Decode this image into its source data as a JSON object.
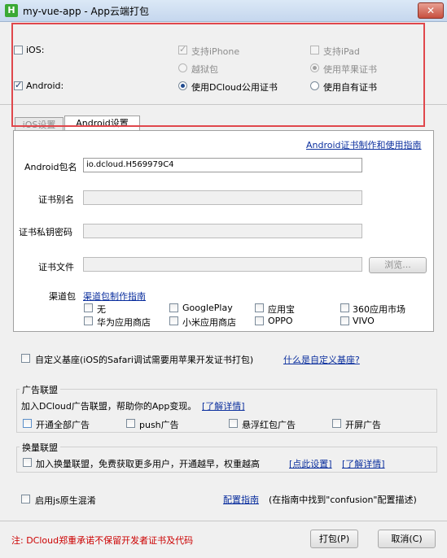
{
  "window": {
    "title": "my-vue-app - App云端打包",
    "icon_letter": "H",
    "close": "✕"
  },
  "platform": {
    "ios_label": "iOS:",
    "iphone": "支持iPhone",
    "ipad": "支持iPad",
    "jailbreak": "越狱包",
    "apple_cert": "使用苹果证书",
    "android_label": "Android:",
    "dcloud_cert": "使用DCloud公用证书",
    "own_cert": "使用自有证书"
  },
  "tabs": {
    "ios": "iOS设置",
    "android": "Android设置"
  },
  "android": {
    "cert_link": "Android证书制作和使用指南",
    "package_label": "Android包名",
    "package_value": "io.dcloud.H569979C4",
    "alias_label": "证书别名",
    "password_label": "证书私钥密码",
    "file_label": "证书文件",
    "browse": "浏览...",
    "channel_label": "渠道包",
    "channel_link": "渠道包制作指南",
    "channels": [
      "无",
      "GooglePlay",
      "应用宝",
      "360应用市场",
      "华为应用商店",
      "小米应用商店",
      "OPPO",
      "VIVO"
    ]
  },
  "custom_base": {
    "label": "自定义基座(iOS的Safari调试需要用苹果开发证书打包)",
    "link": "什么是自定义基座?"
  },
  "ads": {
    "title": "广告联盟",
    "desc": "加入DCloud广告联盟，帮助你的App变现。",
    "learn_more": "[了解详情]",
    "all": "开通全部广告",
    "push": "push广告",
    "float": "悬浮红包广告",
    "splash": "开屏广告"
  },
  "exchange": {
    "title": "换量联盟",
    "label": "加入换量联盟，免费获取更多用户，开通越早，权重越高",
    "settings_link": "[点此设置]",
    "learn_more": "[了解详情]"
  },
  "obfuscation": {
    "label": "启用js原生混淆",
    "guide_link": "配置指南",
    "hint": "(在指南中找到\"confusion\"配置描述)"
  },
  "footer": {
    "note": "注: DCloud郑重承诺不保留开发者证书及代码",
    "pack": "打包(P)",
    "cancel": "取消(C)"
  },
  "colors": {
    "highlight_box": "#e0474c",
    "link": "#0b2f9e",
    "note_red": "#cc0000"
  }
}
